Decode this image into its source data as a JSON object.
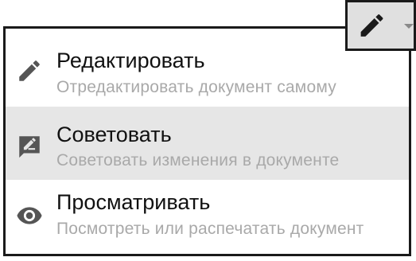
{
  "mode_button": {
    "icon": "pencil-icon",
    "dropdown_icon": "caret-down-icon"
  },
  "menu": {
    "items": [
      {
        "icon": "pencil-icon",
        "title": "Редактировать",
        "description": "Отредактировать документ самому"
      },
      {
        "icon": "suggest-edit-icon",
        "title": "Советовать",
        "description": "Советовать изменения в документе"
      },
      {
        "icon": "eye-icon",
        "title": "Просматривать",
        "description": "Посмотреть или распечатать документ"
      }
    ]
  },
  "colors": {
    "border": "#1a1a1a",
    "highlight": "#e6e6e6",
    "button_bg": "#e0e0e0",
    "icon": "#555555",
    "title": "#111111",
    "description": "#a9a9a9"
  }
}
